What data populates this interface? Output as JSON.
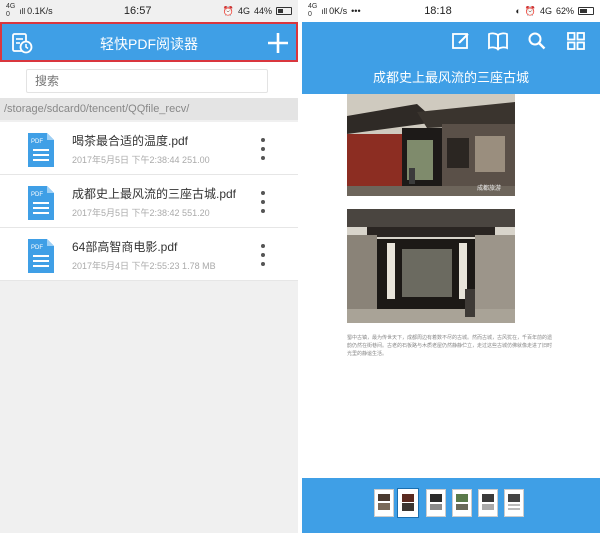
{
  "left": {
    "status": {
      "signal": "4G",
      "speed": "0.1K/s",
      "time": "16:57",
      "network": "4G",
      "battery": "44%",
      "battery_level": 0.44
    },
    "header": {
      "title": "轻快PDF阅读器"
    },
    "search": {
      "placeholder": "搜索"
    },
    "path": "/storage/sdcard0/tencent/QQfile_recv/",
    "files": [
      {
        "name": "喝茶最合适的温度.pdf",
        "meta": "2017年5月5日 下午2:38:44   251.00"
      },
      {
        "name": "成都史上最风流的三座古城.pdf",
        "meta": "2017年5月5日 下午2:38:42   551.20"
      },
      {
        "name": "64部高智商电影.pdf",
        "meta": "2017年5月4日 下午2:55:23   1.78 MB"
      }
    ],
    "icon_label": "PDF"
  },
  "right": {
    "status": {
      "signal": "4G",
      "speed": "0K/s",
      "dots": "•••",
      "time": "18:18",
      "network": "4G",
      "battery": "62%",
      "battery_level": 0.62
    },
    "doc_title": "成都史上最风流的三座古城",
    "body_text": "蜀中古镇，最为传世天下，成都周边有着数不尽的古城。然而古城，古风犹在，千百年前的遗韵仍然在街巷间。古老的石板路与木质老屋仍然静静伫立，走过这些古城仿佛就像走进了旧时光里的静谧生活。",
    "watermark": "成都旅游",
    "thumbnails": 6,
    "active_thumbnail": 2
  },
  "colors": {
    "accent": "#3f9fe6",
    "highlight": "#d9363e"
  }
}
